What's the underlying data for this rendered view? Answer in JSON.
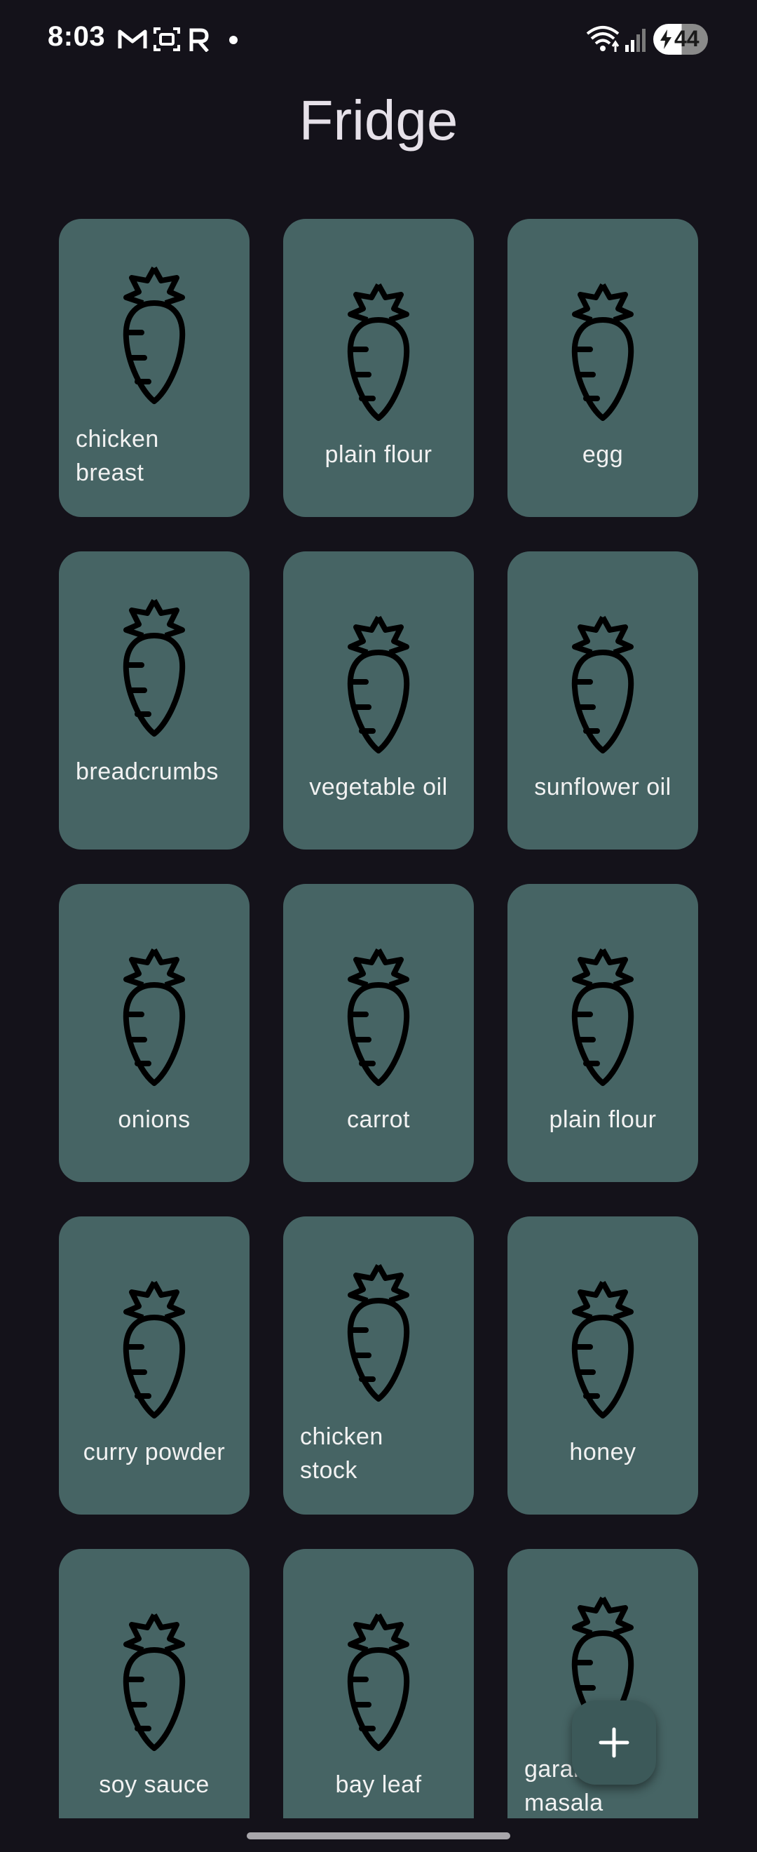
{
  "status_bar": {
    "time": "8:03",
    "battery_level": "44",
    "icons": [
      "gmail-icon",
      "screenshot-icon",
      "r-app-icon",
      "notification-dot-icon",
      "wifi-icon",
      "signal-icon",
      "battery-charging-icon"
    ]
  },
  "title": "Fridge",
  "items": [
    {
      "label": "chicken breast",
      "icon": "carrot-icon"
    },
    {
      "label": "plain flour",
      "icon": "carrot-icon"
    },
    {
      "label": "egg",
      "icon": "carrot-icon"
    },
    {
      "label": "breadcrumbs",
      "icon": "carrot-icon"
    },
    {
      "label": "vegetable oil",
      "icon": "carrot-icon"
    },
    {
      "label": "sunflower oil",
      "icon": "carrot-icon"
    },
    {
      "label": "onions",
      "icon": "carrot-icon"
    },
    {
      "label": "carrot",
      "icon": "carrot-icon"
    },
    {
      "label": "plain flour",
      "icon": "carrot-icon"
    },
    {
      "label": "curry powder",
      "icon": "carrot-icon"
    },
    {
      "label": "chicken stock",
      "icon": "carrot-icon"
    },
    {
      "label": "honey",
      "icon": "carrot-icon"
    },
    {
      "label": "soy sauce",
      "icon": "carrot-icon"
    },
    {
      "label": "bay leaf",
      "icon": "carrot-icon"
    },
    {
      "label": "garam masala",
      "icon": "carrot-icon"
    }
  ],
  "fab": {
    "icon": "plus-icon"
  },
  "colors": {
    "background": "#14121a",
    "card": "#466464",
    "fab": "#3c5959",
    "text": "#e6e1e9"
  }
}
